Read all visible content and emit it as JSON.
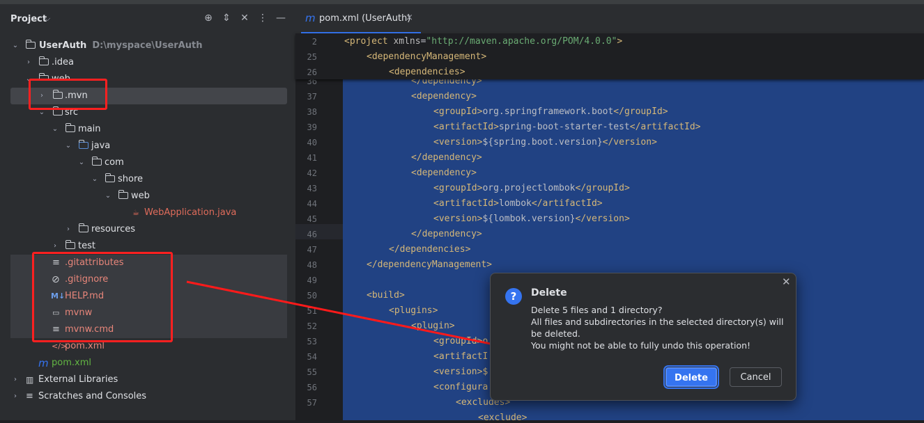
{
  "project": {
    "title": "Project",
    "tree": [
      {
        "label": "UserAuth",
        "path": "D:\\myspace\\UserAuth"
      },
      {
        "label": ".idea"
      },
      {
        "label": "web"
      },
      {
        "label": ".mvn"
      },
      {
        "label": "src"
      },
      {
        "label": "main"
      },
      {
        "label": "java"
      },
      {
        "label": "com"
      },
      {
        "label": "shore"
      },
      {
        "label": "web"
      },
      {
        "label": "WebApplication.java"
      },
      {
        "label": "resources"
      },
      {
        "label": "test"
      },
      {
        "label": ".gitattributes"
      },
      {
        "label": ".gitignore"
      },
      {
        "label": "HELP.md"
      },
      {
        "label": "mvnw"
      },
      {
        "label": "mvnw.cmd"
      },
      {
        "label": "pom.xml"
      },
      {
        "label": "pom.xml"
      },
      {
        "label": "External Libraries"
      },
      {
        "label": "Scratches and Consoles"
      }
    ]
  },
  "editor": {
    "tab_label": "pom.xml (UserAuth)",
    "sticky_lines": [
      {
        "n": "2",
        "tag": "<project ",
        "attr": "xmlns",
        "eq": "=",
        "str": "\"http://maven.apache.org/POM/4.0.0\"",
        "end": ">"
      },
      {
        "n": "25",
        "tag": "<dependencyManagement>"
      },
      {
        "n": "26",
        "tag": "<dependencies>"
      }
    ],
    "lines": [
      {
        "n": "36",
        "text": "</dependency>"
      },
      {
        "n": "37",
        "text": "<dependency>"
      },
      {
        "n": "38",
        "open": "<groupId>",
        "val": "org.springframework.boot",
        "close": "</groupId>"
      },
      {
        "n": "39",
        "open": "<artifactId>",
        "val": "spring-boot-starter-test",
        "close": "</artifactId>"
      },
      {
        "n": "40",
        "open": "<version>",
        "val": "${spring.boot.version}",
        "close": "</version>"
      },
      {
        "n": "41",
        "text": "</dependency>"
      },
      {
        "n": "42",
        "text": "<dependency>"
      },
      {
        "n": "43",
        "open": "<groupId>",
        "val": "org.projectlombok",
        "close": "</groupId>"
      },
      {
        "n": "44",
        "open": "<artifactId>",
        "val": "lombok",
        "close": "</artifactId>"
      },
      {
        "n": "45",
        "open": "<version>",
        "val": "${lombok.version}",
        "close": "</version>"
      },
      {
        "n": "46",
        "text": "</dependency>"
      },
      {
        "n": "47",
        "text": "</dependencies>"
      },
      {
        "n": "48",
        "text": "</dependencyManagement>"
      },
      {
        "n": "49",
        "text": ""
      },
      {
        "n": "50",
        "text": "<build>"
      },
      {
        "n": "51",
        "text": "<plugins>"
      },
      {
        "n": "52",
        "text": "<plugin>"
      },
      {
        "n": "53",
        "text": "<groupId>o"
      },
      {
        "n": "54",
        "text": "<artifactI"
      },
      {
        "n": "55",
        "text": "<version>$"
      },
      {
        "n": "56",
        "text": "<configura"
      },
      {
        "n": "57",
        "text": "<excludes>"
      },
      {
        "n": "",
        "text": "<exclude>"
      }
    ]
  },
  "dialog": {
    "title": "Delete",
    "question": "Delete 5 files and 1 directory?",
    "detail": "All files and subdirectories in the selected directory(s) will be deleted.",
    "warning": "You might not be able to fully undo this operation!",
    "delete_label": "Delete",
    "cancel_label": "Cancel"
  },
  "colors": {
    "accent": "#3574f0",
    "annotation": "#ff2020",
    "selection": "#214283"
  }
}
